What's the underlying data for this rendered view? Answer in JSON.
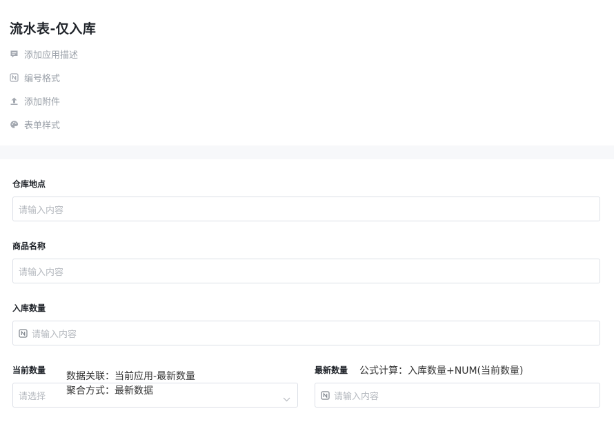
{
  "header": {
    "title": "流水表-仅入库",
    "meta_items": [
      {
        "label": "添加应用描述",
        "icon": "comment-icon"
      },
      {
        "label": "编号格式",
        "icon": "number-format-icon"
      },
      {
        "label": "添加附件",
        "icon": "upload-icon"
      },
      {
        "label": "表单样式",
        "icon": "palette-icon"
      }
    ]
  },
  "form": {
    "warehouse": {
      "label": "仓库地点",
      "placeholder": "请输入内容"
    },
    "product": {
      "label": "商品名称",
      "placeholder": "请输入内容"
    },
    "inbound_qty": {
      "label": "入库数量",
      "placeholder": "请输入内容"
    },
    "current_qty": {
      "label": "当前数量",
      "placeholder": "请选择",
      "relation_line": "数据关联：当前应用-最新数量",
      "aggregate_line": "聚合方式：最新数据"
    },
    "latest_qty": {
      "label": "最新数量",
      "formula": "公式计算：入库数量+NUM(当前数量)",
      "placeholder": "请输入内容"
    }
  },
  "colors": {
    "border": "#dcdfe6",
    "placeholder": "#b5b9bf",
    "muted": "#9aa0a8"
  }
}
